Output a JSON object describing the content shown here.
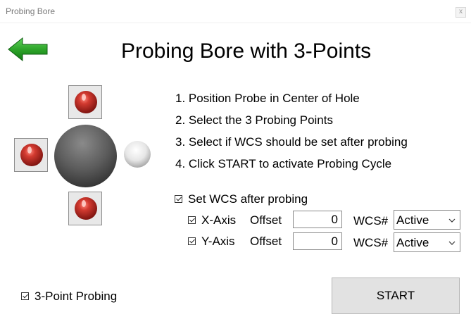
{
  "window": {
    "title": "Probing Bore",
    "close_glyph": "x"
  },
  "back_button": {
    "icon": "green-left-arrow-icon"
  },
  "heading": "Probing Bore with 3-Points",
  "instructions": [
    "1. Position Probe in Center of Hole",
    "2. Select the 3 Probing Points",
    "3. Select if WCS should be set after probing",
    "4. Click START to activate Probing Cycle"
  ],
  "probe_points": {
    "top": {
      "state": "selected",
      "color": "#b52a23"
    },
    "left": {
      "state": "selected",
      "color": "#b52a23"
    },
    "bottom": {
      "state": "selected",
      "color": "#b52a23"
    },
    "right": {
      "state": "unselected",
      "color": "#e4e4e4"
    }
  },
  "set_wcs": {
    "label": "Set WCS after probing",
    "checked": true
  },
  "x_axis": {
    "label": "X-Axis",
    "offset_label": "Offset",
    "offset_value": "0",
    "wcs_label": "WCS#",
    "wcs_value": "Active",
    "checked": true
  },
  "y_axis": {
    "label": "Y-Axis",
    "offset_label": "Offset",
    "offset_value": "0",
    "wcs_label": "WCS#",
    "wcs_value": "Active",
    "checked": true
  },
  "three_point": {
    "label": "3-Point Probing",
    "checked": true
  },
  "start_button": {
    "label": "START"
  }
}
